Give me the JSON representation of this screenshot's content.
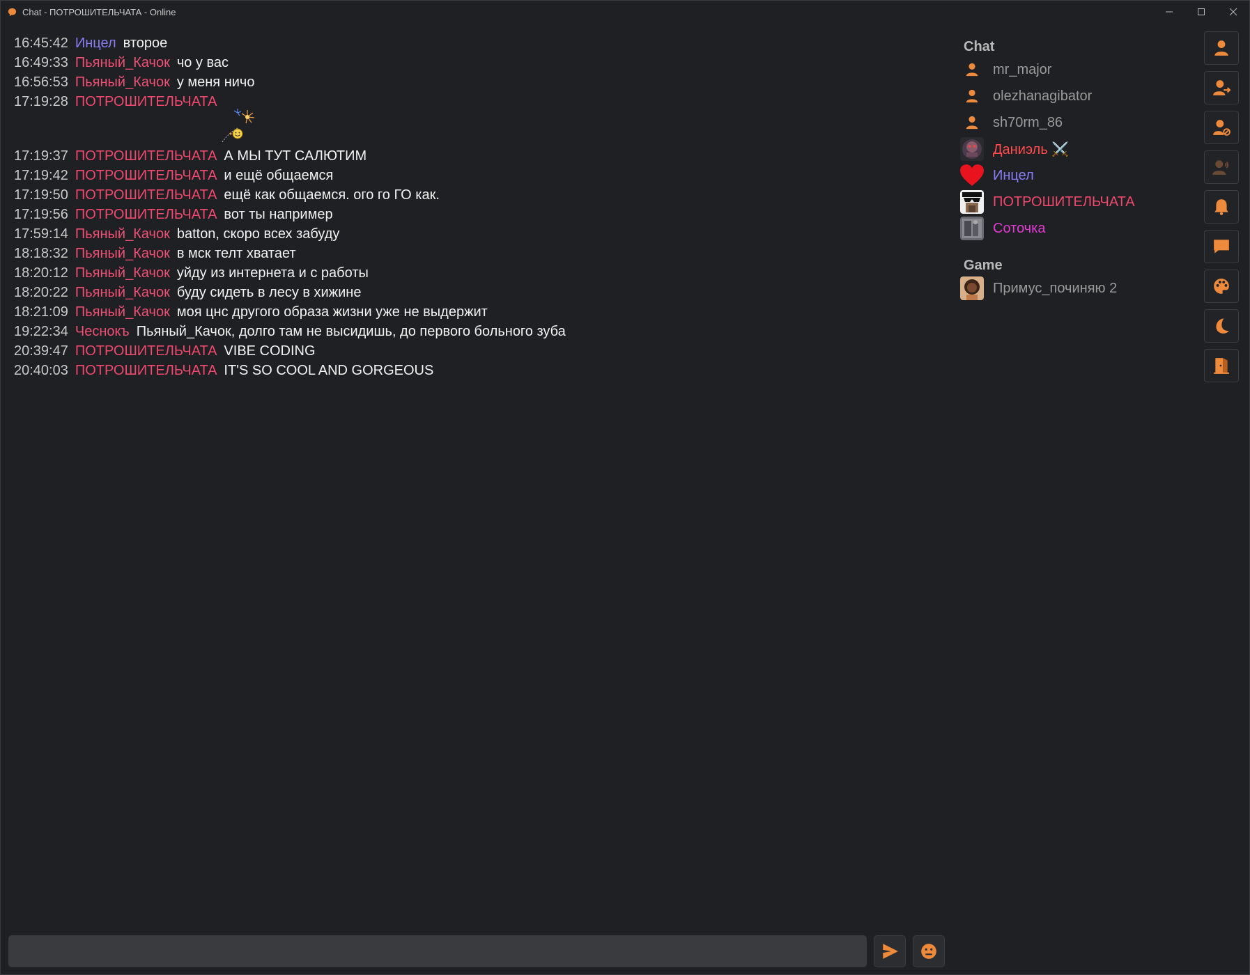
{
  "window": {
    "title": "Chat - ПОТРОШИТЕЛЬЧАТА - Online",
    "accent": "#ee8a3c"
  },
  "messages": [
    {
      "time": "16:45:42",
      "user": "Инцел",
      "text": "второе",
      "color": "u-purple"
    },
    {
      "time": "16:49:33",
      "user": "Пьяный_Качок",
      "text": "чо у вас",
      "color": "u-pink2"
    },
    {
      "time": "16:56:53",
      "user": "Пьяный_Качок",
      "text": "у меня ничо",
      "color": "u-pink2"
    },
    {
      "time": "17:19:28",
      "user": "ПОТРОШИТЕЛЬЧАТА",
      "text": "",
      "color": "u-pink",
      "image": "fireworks-smiley"
    },
    {
      "time": "17:19:37",
      "user": "ПОТРОШИТЕЛЬЧАТА",
      "text": "А МЫ ТУТ САЛЮТИМ",
      "color": "u-pink"
    },
    {
      "time": "17:19:42",
      "user": "ПОТРОШИТЕЛЬЧАТА",
      "text": "и ещё общаемся",
      "color": "u-pink"
    },
    {
      "time": "17:19:50",
      "user": "ПОТРОШИТЕЛЬЧАТА",
      "text": "ещё как общаемся. ого го ГО как.",
      "color": "u-pink"
    },
    {
      "time": "17:19:56",
      "user": "ПОТРОШИТЕЛЬЧАТА",
      "text": "вот ты например",
      "color": "u-pink"
    },
    {
      "time": "17:59:14",
      "user": "Пьяный_Качок",
      "text": "batton, скоро всех забуду",
      "color": "u-pink2"
    },
    {
      "time": "18:18:32",
      "user": "Пьяный_Качок",
      "text": "в мск телт хватает",
      "color": "u-pink2"
    },
    {
      "time": "18:20:12",
      "user": "Пьяный_Качок",
      "text": "уйду из интернета и с работы",
      "color": "u-pink2"
    },
    {
      "time": "18:20:22",
      "user": "Пьяный_Качок",
      "text": "буду сидеть в лесу в хижине",
      "color": "u-pink2"
    },
    {
      "time": "18:21:09",
      "user": "Пьяный_Качок",
      "text": "моя цнс другого образа жизни уже не выдержит",
      "color": "u-pink2"
    },
    {
      "time": "19:22:34",
      "user": "Чеснокъ",
      "text": "Пьяный_Качок, долго там не высидишь, до первого больного зуба",
      "color": "u-pink2"
    },
    {
      "time": "20:39:47",
      "user": "ПОТРОШИТЕЛЬЧАТА",
      "text": "VIBE CODING",
      "color": "u-pink"
    },
    {
      "time": "20:40:03",
      "user": "ПОТРОШИТЕЛЬЧАТА",
      "text": "IT'S SO COOL AND GORGEOUS",
      "color": "u-pink"
    }
  ],
  "users_panel": {
    "chat_title": "Chat",
    "game_title": "Game",
    "chat_users": [
      {
        "name": "mr_major",
        "color": "#9a9a9a",
        "avatar": "person-icon"
      },
      {
        "name": "olezhanagibator",
        "color": "#9a9a9a",
        "avatar": "person-icon"
      },
      {
        "name": "sh70rm_86",
        "color": "#9a9a9a",
        "avatar": "person-icon"
      },
      {
        "name": "Даниэль ⚔️",
        "color": "#ff4d4d",
        "avatar": "mask-avatar"
      },
      {
        "name": "Инцел",
        "color": "#8a7cf4",
        "avatar": "heart-avatar"
      },
      {
        "name": "ПОТРОШИТЕЛЬЧАТА",
        "color": "#f0486e",
        "avatar": "sunglasses-avatar"
      },
      {
        "name": "Соточка",
        "color": "#e03bd2",
        "avatar": "photo-avatar"
      }
    ],
    "game_users": [
      {
        "name": "Примус_починяю 2",
        "color": "#9a9a9a",
        "avatar": "portrait-avatar"
      }
    ]
  },
  "toolbar": [
    "profile-icon",
    "add-user-icon",
    "block-user-icon",
    "voice-icon",
    "bell-icon",
    "chat-bubble-icon",
    "palette-icon",
    "moon-icon",
    "exit-door-icon"
  ],
  "input": {
    "placeholder": "",
    "value": ""
  }
}
